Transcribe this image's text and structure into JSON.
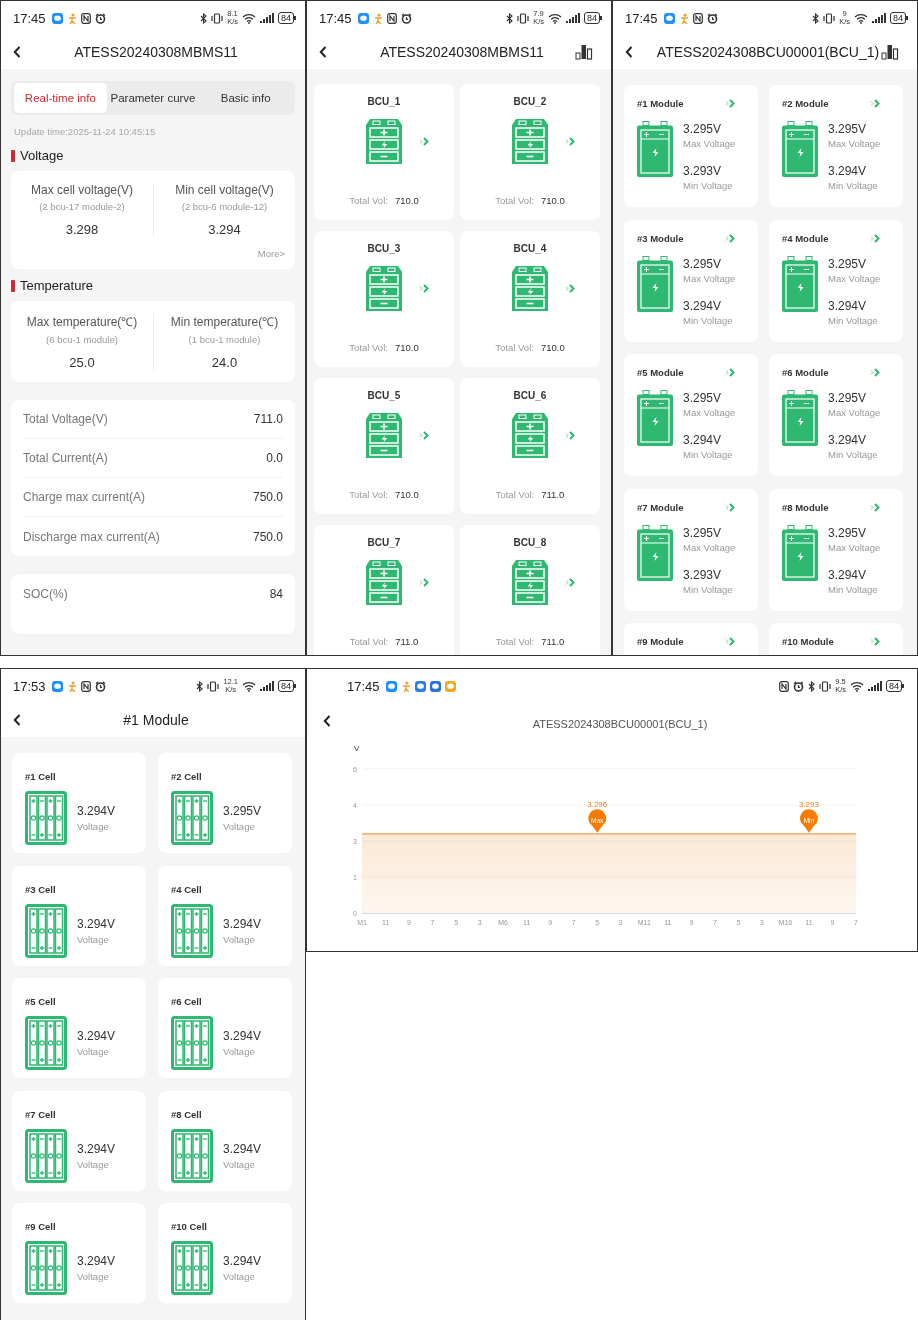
{
  "screens": [
    {
      "kind": "realtime",
      "status_bar": {
        "time": "17:45",
        "speed": "8.1",
        "speed_unit": "K/s",
        "battery": "84"
      },
      "title": "ATESS20240308MBMS11",
      "tabs": [
        {
          "label": "Real-time info",
          "selected": true
        },
        {
          "label": "Parameter curve",
          "selected": false
        },
        {
          "label": "Basic info",
          "selected": false
        }
      ],
      "update_time": "Update time:2025-11-24 10:45:15",
      "sections": [
        {
          "heading": "Voltage",
          "stats": [
            {
              "label": "Max cell voltage(V)",
              "location": "(2 bcu-17 module-2)",
              "value": "3.298"
            },
            {
              "label": "Min cell voltage(V)",
              "location": "(2 bcu-6 module-12)",
              "value": "3.294"
            }
          ],
          "more_link": "More>"
        },
        {
          "heading": "Temperature",
          "stats": [
            {
              "label": "Max temperature(℃)",
              "location": "(6 bcu-1 module)",
              "value": "25.0"
            },
            {
              "label": "Min temperature(℃)",
              "location": "(1 bcu-1 module)",
              "value": "24.0"
            }
          ]
        }
      ],
      "parameters": [
        {
          "label": "Total Voltage(V)",
          "value": "711.0"
        },
        {
          "label": "Total Current(A)",
          "value": "0.0"
        },
        {
          "label": "Charge max current(A)",
          "value": "750.0"
        },
        {
          "label": "Discharge max current(A)",
          "value": "750.0"
        }
      ],
      "soc": {
        "label": "SOC(%)",
        "value": "84"
      }
    },
    {
      "kind": "bcu_list",
      "status_bar": {
        "time": "17:45",
        "speed": "7.9",
        "speed_unit": "K/s",
        "battery": "84"
      },
      "title": "ATESS20240308MBMS11",
      "bcus": [
        {
          "name": "BCU_1",
          "total_label": "Total Vol:",
          "total": "710.0"
        },
        {
          "name": "BCU_2",
          "total_label": "Total Vol:",
          "total": "710.0"
        },
        {
          "name": "BCU_3",
          "total_label": "Total Vol:",
          "total": "710.0"
        },
        {
          "name": "BCU_4",
          "total_label": "Total Vol:",
          "total": "710.0"
        },
        {
          "name": "BCU_5",
          "total_label": "Total Vol:",
          "total": "710.0"
        },
        {
          "name": "BCU_6",
          "total_label": "Total Vol:",
          "total": "711.0"
        },
        {
          "name": "BCU_7",
          "total_label": "Total Vol:",
          "total": "711.0"
        },
        {
          "name": "BCU_8",
          "total_label": "Total Vol:",
          "total": "711.0"
        }
      ]
    },
    {
      "kind": "module_list",
      "status_bar": {
        "time": "17:45",
        "speed": "9",
        "speed_unit": "K/s",
        "battery": "84"
      },
      "title": "ATESS2024308BCU00001(BCU_1)",
      "modules": [
        {
          "name": "#1 Module",
          "max": "3.295V",
          "max_label": "Max Voltage",
          "min": "3.293V",
          "min_label": "Min Voltage"
        },
        {
          "name": "#2 Module",
          "max": "3.295V",
          "max_label": "Max Voltage",
          "min": "3.294V",
          "min_label": "Min Voltage"
        },
        {
          "name": "#3 Module",
          "max": "3.295V",
          "max_label": "Max Voltage",
          "min": "3.294V",
          "min_label": "Min Voltage"
        },
        {
          "name": "#4 Module",
          "max": "3.295V",
          "max_label": "Max Voltage",
          "min": "3.294V",
          "min_label": "Min Voltage"
        },
        {
          "name": "#5 Module",
          "max": "3.295V",
          "max_label": "Max Voltage",
          "min": "3.294V",
          "min_label": "Min Voltage"
        },
        {
          "name": "#6 Module",
          "max": "3.295V",
          "max_label": "Max Voltage",
          "min": "3.294V",
          "min_label": "Min Voltage"
        },
        {
          "name": "#7 Module",
          "max": "3.295V",
          "max_label": "Max Voltage",
          "min": "3.293V",
          "min_label": "Min Voltage"
        },
        {
          "name": "#8 Module",
          "max": "3.295V",
          "max_label": "Max Voltage",
          "min": "3.294V",
          "min_label": "Min Voltage"
        },
        {
          "name": "#9 Module"
        },
        {
          "name": "#10 Module"
        }
      ]
    },
    {
      "kind": "cell_list",
      "status_bar": {
        "time": "17:53",
        "speed": "12.1",
        "speed_unit": "K/s",
        "battery": "84"
      },
      "title": "#1 Module",
      "cells": [
        {
          "name": "#1 Cell",
          "voltage": "3.294V",
          "label": "Voltage"
        },
        {
          "name": "#2 Cell",
          "voltage": "3.295V",
          "label": "Voltage"
        },
        {
          "name": "#3 Cell",
          "voltage": "3.294V",
          "label": "Voltage"
        },
        {
          "name": "#4 Cell",
          "voltage": "3.294V",
          "label": "Voltage"
        },
        {
          "name": "#5 Cell",
          "voltage": "3.294V",
          "label": "Voltage"
        },
        {
          "name": "#6 Cell",
          "voltage": "3.294V",
          "label": "Voltage"
        },
        {
          "name": "#7 Cell",
          "voltage": "3.294V",
          "label": "Voltage"
        },
        {
          "name": "#8 Cell",
          "voltage": "3.294V",
          "label": "Voltage"
        },
        {
          "name": "#9 Cell",
          "voltage": "3.294V",
          "label": "Voltage"
        },
        {
          "name": "#10 Cell",
          "voltage": "3.294V",
          "label": "Voltage"
        }
      ]
    },
    {
      "kind": "chart",
      "status_bar": {
        "time": "17:45",
        "speed": "9.5",
        "speed_unit": "K/s",
        "battery": "84"
      },
      "title": "ATESS2024308BCU00001(BCU_1)",
      "chart_data": {
        "type": "area",
        "ylabel": "V",
        "categories": [
          "M1",
          "11",
          "9",
          "7",
          "5",
          "3",
          "M6",
          "11",
          "9",
          "7",
          "5",
          "3",
          "M11",
          "11",
          "9",
          "7",
          "5",
          "3",
          "M16",
          "11",
          "9",
          "7"
        ],
        "series": [
          {
            "color": "#f0a050",
            "values": [
              3.3,
              3.3,
              3.3,
              3.3,
              3.3,
              3.3,
              3.3,
              3.3,
              3.3,
              3.3,
              3.3,
              3.3,
              3.3,
              3.3,
              3.3,
              3.3,
              3.3,
              3.3,
              3.3,
              3.3,
              3.3,
              3.3
            ]
          }
        ],
        "ylim": [
          0,
          6
        ],
        "yticks": [
          0,
          {
            "value": 1.5,
            "label": "1"
          },
          3,
          {
            "value": 4.5,
            "label": "4"
          },
          6
        ],
        "grid": true,
        "annotations": [
          "3.296",
          "3.293"
        ]
      },
      "markers": [
        {
          "label": "Max"
        },
        {
          "label": "Min"
        }
      ]
    }
  ]
}
